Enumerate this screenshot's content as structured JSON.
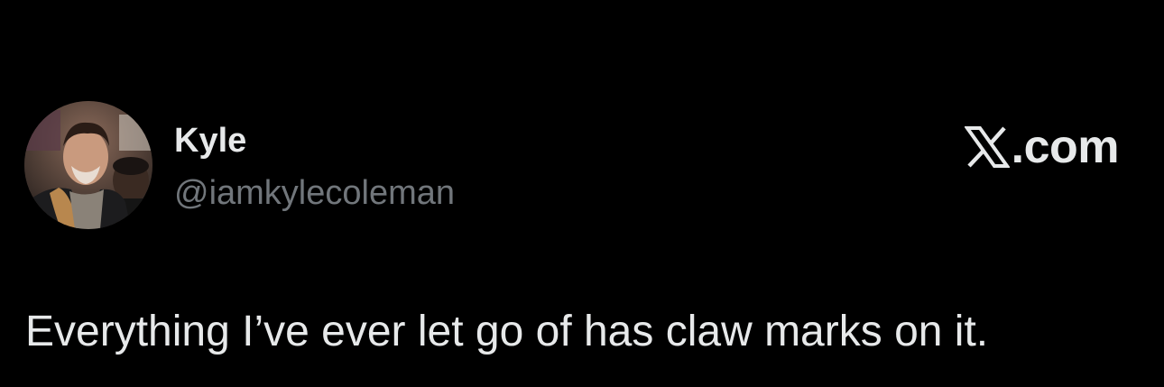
{
  "author": {
    "display_name": "Kyle",
    "handle": "@iamkylecoleman",
    "avatar_icon": "profile-photo"
  },
  "brand": {
    "icon": "x-logo-icon",
    "text": ".com"
  },
  "tweet": {
    "text": "Everything I’ve ever let go of has claw marks on it."
  },
  "colors": {
    "background": "#000000",
    "primary_text": "#e7e9ea",
    "secondary_text": "#71767b"
  }
}
